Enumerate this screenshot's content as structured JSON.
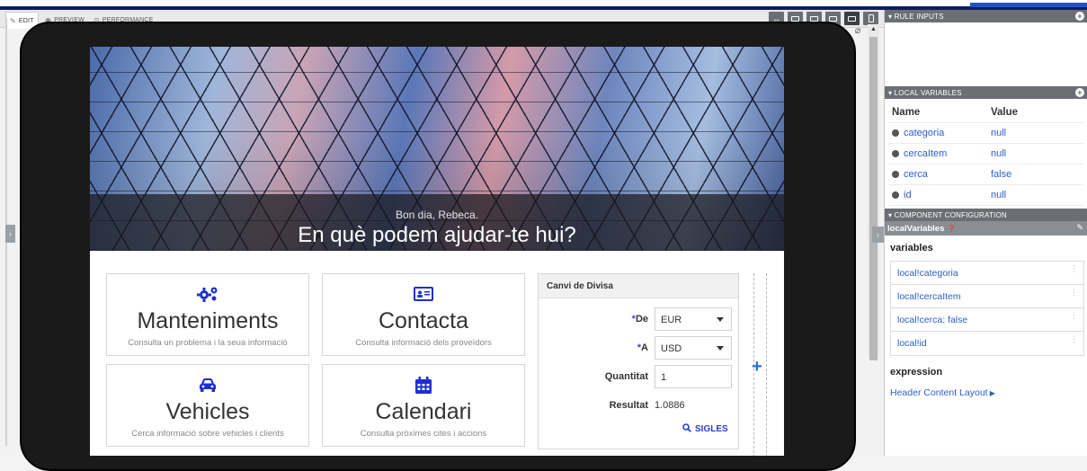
{
  "tabs": [
    {
      "label": "EDIT",
      "icon": "pencil-icon"
    },
    {
      "label": "PREVIEW",
      "icon": "eye-icon"
    },
    {
      "label": "PERFORMANCE",
      "icon": "gauge-icon"
    }
  ],
  "hero": {
    "greeting": "Bon dia, Rebeca.",
    "headline": "En què podem ajudar-te hui?"
  },
  "cards": [
    {
      "title": "Manteniments",
      "subtitle": "Consulta un problema i la seua informació",
      "icon": "gears-icon"
    },
    {
      "title": "Contacta",
      "subtitle": "Consulta informació dels proveïdors",
      "icon": "id-card-icon"
    },
    {
      "title": "Vehicles",
      "subtitle": "Cerca informació sobre vehicles i clients",
      "icon": "car-icon"
    },
    {
      "title": "Calendari",
      "subtitle": "Consulta pròximes cites i accions",
      "icon": "calendar-icon"
    }
  ],
  "currency": {
    "title": "Canvi de Divisa",
    "from_label": "De",
    "from_value": "EUR",
    "to_label": "A",
    "to_value": "USD",
    "amount_label": "Quantitat",
    "amount_value": "1",
    "result_label": "Resultat",
    "result_value": "1.0886",
    "codes_link": "SIGLES",
    "required_marker": "*"
  },
  "side": {
    "rule_inputs": "RULE INPUTS",
    "local_variables": "LOCAL VARIABLES",
    "table_headers": [
      "Name",
      "Value"
    ],
    "variables": [
      {
        "name": "categoria",
        "value": "null"
      },
      {
        "name": "cercaItem",
        "value": "null"
      },
      {
        "name": "cerca",
        "value": "false"
      },
      {
        "name": "id",
        "value": "null"
      }
    ],
    "component_config": "COMPONENT CONFIGURATION",
    "component_name": "localVariables",
    "variables_label": "variables",
    "variable_entries": [
      "local!categoria",
      "local!cercaItem",
      "local!cerca: false",
      "local!id"
    ],
    "expression_label": "expression",
    "expression_link": "Header Content Layout"
  },
  "colors": {
    "accent": "#2b5fc7",
    "dark_blue": "#0f1d5c",
    "icon_blue": "#1d2fd0",
    "header_gray": "#6b6f74"
  }
}
